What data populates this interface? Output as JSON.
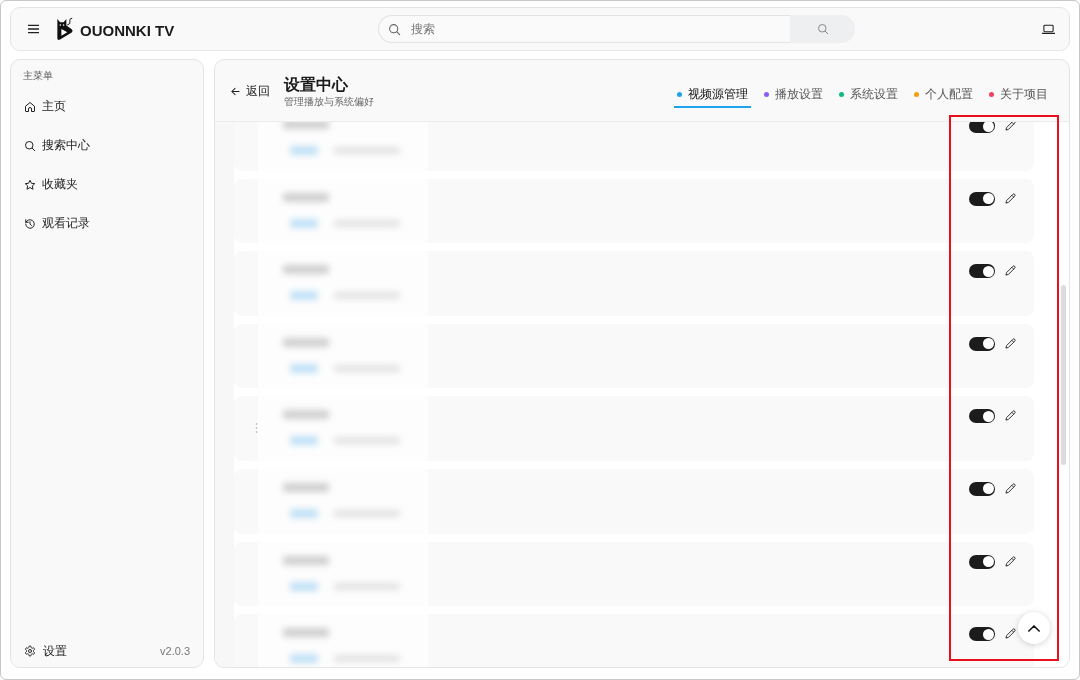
{
  "top_bar": {
    "brand": "OUONNKI TV",
    "search": {
      "placeholder": "搜索"
    }
  },
  "sidebar": {
    "section_title": "主菜单",
    "items": [
      {
        "kind": "home",
        "label": "主页",
        "selected": false
      },
      {
        "kind": "search",
        "label": "搜索中心",
        "selected": false
      },
      {
        "kind": "star",
        "label": "收藏夹",
        "selected": false
      },
      {
        "kind": "history",
        "label": "观看记录",
        "selected": false
      }
    ],
    "footer": {
      "label": "设置",
      "version": "v2.0.3"
    }
  },
  "settings": {
    "back": "返回",
    "title": "设置中心",
    "subtitle": "管理播放与系统偏好",
    "tabs": [
      {
        "label": "视频源管理",
        "color": "#1ea4ea",
        "selected": true
      },
      {
        "label": "播放设置",
        "color": "#8b5cf6",
        "selected": false
      },
      {
        "label": "系统设置",
        "color": "#10b981",
        "selected": false
      },
      {
        "label": "个人配置",
        "color": "#f59e0b",
        "selected": false
      },
      {
        "label": "关于项目",
        "color": "#f43f5e",
        "selected": false
      }
    ],
    "sources": [
      {
        "on": true,
        "handle": false
      },
      {
        "on": true,
        "handle": false
      },
      {
        "on": true,
        "handle": false
      },
      {
        "on": true,
        "handle": false
      },
      {
        "on": true,
        "handle": true
      },
      {
        "on": true,
        "handle": false
      },
      {
        "on": true,
        "handle": false
      },
      {
        "on": true,
        "handle": false
      }
    ]
  },
  "annotation": {
    "highlight": true
  }
}
